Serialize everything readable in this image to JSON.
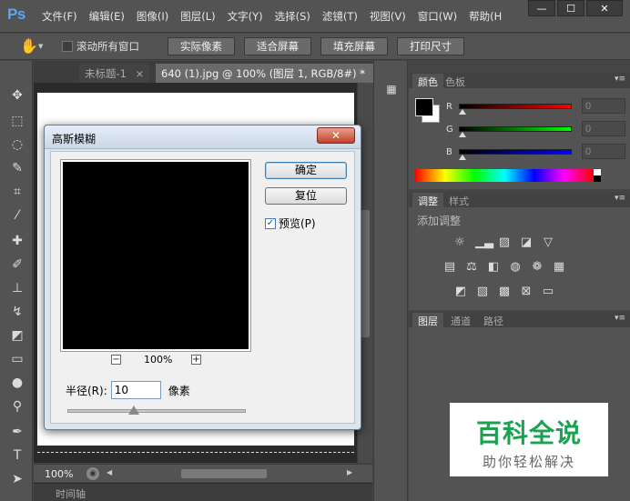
{
  "app": {
    "logo": "Ps",
    "menu": [
      "文件(F)",
      "编辑(E)",
      "图像(I)",
      "图层(L)",
      "文字(Y)",
      "选择(S)",
      "滤镜(T)",
      "视图(V)",
      "窗口(W)",
      "帮助(H"
    ],
    "window_buttons": {
      "minimize": "—",
      "maximize": "☐",
      "close": "✕"
    }
  },
  "options_bar": {
    "tool_icon": "hand-icon",
    "scroll_all_label": "滚动所有窗口",
    "buttons": [
      "实际像素",
      "适合屏幕",
      "填充屏幕",
      "打印尺寸"
    ]
  },
  "document": {
    "tabs": [
      {
        "label": "未标题-1",
        "close": "×"
      },
      {
        "label": "640 (1).jpg @ 100% (图层 1, RGB/8#) *",
        "close": "×"
      }
    ],
    "tabs_more": "»",
    "zoom": "100%",
    "timeline_label": "时间轴"
  },
  "panels": {
    "color": {
      "tabs": [
        "颜色",
        "色板"
      ],
      "channels": [
        {
          "label": "R",
          "value": "0",
          "color": "#ff0000"
        },
        {
          "label": "G",
          "value": "0",
          "color": "#00ff00"
        },
        {
          "label": "B",
          "value": "0",
          "color": "#0000ff"
        }
      ]
    },
    "adjustments": {
      "tabs": [
        "调整",
        "样式"
      ],
      "title": "添加调整"
    },
    "layers": {
      "tabs": [
        "图层",
        "通道",
        "路径"
      ]
    }
  },
  "dialog": {
    "title": "高斯模糊",
    "close_glyph": "✕",
    "ok_label": "确定",
    "reset_label": "复位",
    "preview_label": "预览(P)",
    "preview_checked": "✓",
    "zoom_percent": "100%",
    "zoom_out": "−",
    "zoom_in": "+",
    "radius_label": "半径(R):",
    "radius_value": "10",
    "radius_unit": "像素",
    "radius_slider_position": 0.37
  },
  "watermark": {
    "main": "百科全说",
    "sub": "助你轻松解决"
  }
}
